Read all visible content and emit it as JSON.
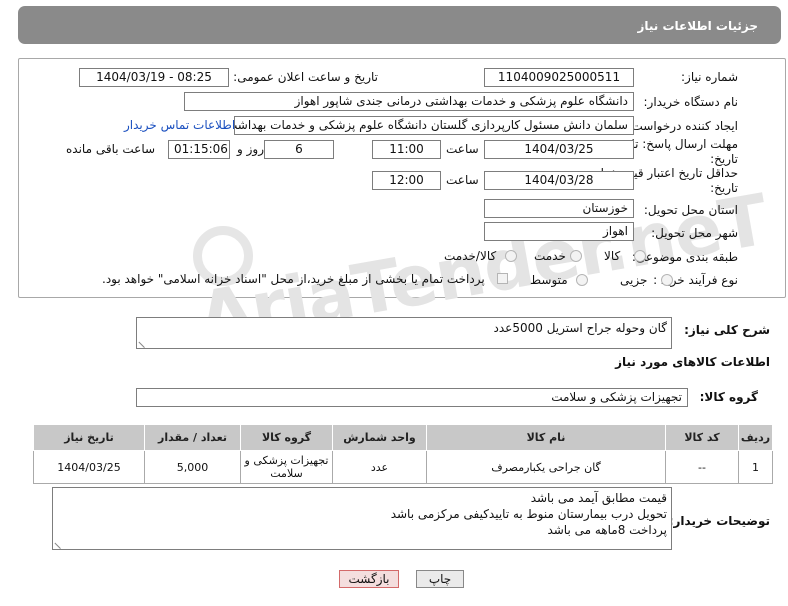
{
  "header": {
    "title": "جزئیات اطلاعات نیاز"
  },
  "form": {
    "need_number_label": "شماره نیاز:",
    "need_number": "1104009025000511",
    "announce_label": "تاریخ و ساعت اعلان عمومی:",
    "announce_value": "1404/03/19 - 08:25",
    "buyer_org_label": "نام دستگاه خریدار:",
    "buyer_org": "دانشگاه علوم پزشکی و خدمات بهداشتی درمانی جندی شاپور اهواز",
    "requester_label": "ایجاد کننده درخواست:",
    "requester": "سلمان دانش مسئول کارپردازی گلستان دانشگاه علوم پزشکی و خدمات بهداشت",
    "buyer_contact_link": "اطلاعات تماس خریدار",
    "deadline_label": "مهلت ارسال پاسخ: تا تاریخ:",
    "deadline_date": "1404/03/25",
    "time_label": "ساعت",
    "deadline_time": "11:00",
    "days_value": "6",
    "days_label": "روز و",
    "remaining_time": "01:15:06",
    "remaining_label": "ساعت باقی مانده",
    "validity_label": "حداقل تاریخ اعتبار قیمت: تا تاریخ:",
    "validity_date": "1404/03/28",
    "validity_time": "12:00",
    "province_label": "استان محل تحویل:",
    "province": "خوزستان",
    "city_label": "شهر محل تحویل:",
    "city": "اهواز",
    "category_label": "طبقه بندی موضوعی:",
    "category_options": [
      "کالا",
      "خدمت",
      "کالا/خدمت"
    ],
    "process_label": "نوع فرآیند خرید :",
    "process_options": [
      "جزیی",
      "متوسط"
    ],
    "payment_note": "پرداخت تمام یا بخشی از مبلغ خرید،از محل \"اسناد خزانه اسلامی\" خواهد بود."
  },
  "description": {
    "label": "شرح کلی نیاز:",
    "text": "گان وحوله جراح استریل 5000عدد"
  },
  "goods": {
    "section_title": "اطلاعات کالاهای مورد نیاز",
    "group_label": "گروه کالا:",
    "group_value": "تجهیزات پزشکی و سلامت",
    "columns": [
      "ردیف",
      "کد کالا",
      "نام کالا",
      "واحد شمارش",
      "گروه کالا",
      "تعداد / مقدار",
      "تاریخ نیاز"
    ],
    "rows": [
      {
        "row": "1",
        "code": "--",
        "name": "گان جراحی یکبارمصرف",
        "unit": "عدد",
        "group": "تجهیزات پزشکی و سلامت",
        "qty": "5,000",
        "date": "1404/03/25"
      }
    ]
  },
  "buyer_notes": {
    "label": "توضیحات خریدار:",
    "lines": [
      "قیمت مطابق آیمد می باشد",
      "تحویل درب بیمارستان منوط به تاییدکیفی مرکزمی باشد",
      "پرداخت 8ماهه می باشد"
    ]
  },
  "buttons": {
    "print": "چاپ",
    "back": "بازگشت"
  },
  "watermark": {
    "text": "AriaTender.neT"
  },
  "colors": {
    "header_bg": "#8a8a8a",
    "table_header_bg": "#c8c8c8",
    "link": "#1a4fbf",
    "back_button_border": "#d36a6a"
  }
}
